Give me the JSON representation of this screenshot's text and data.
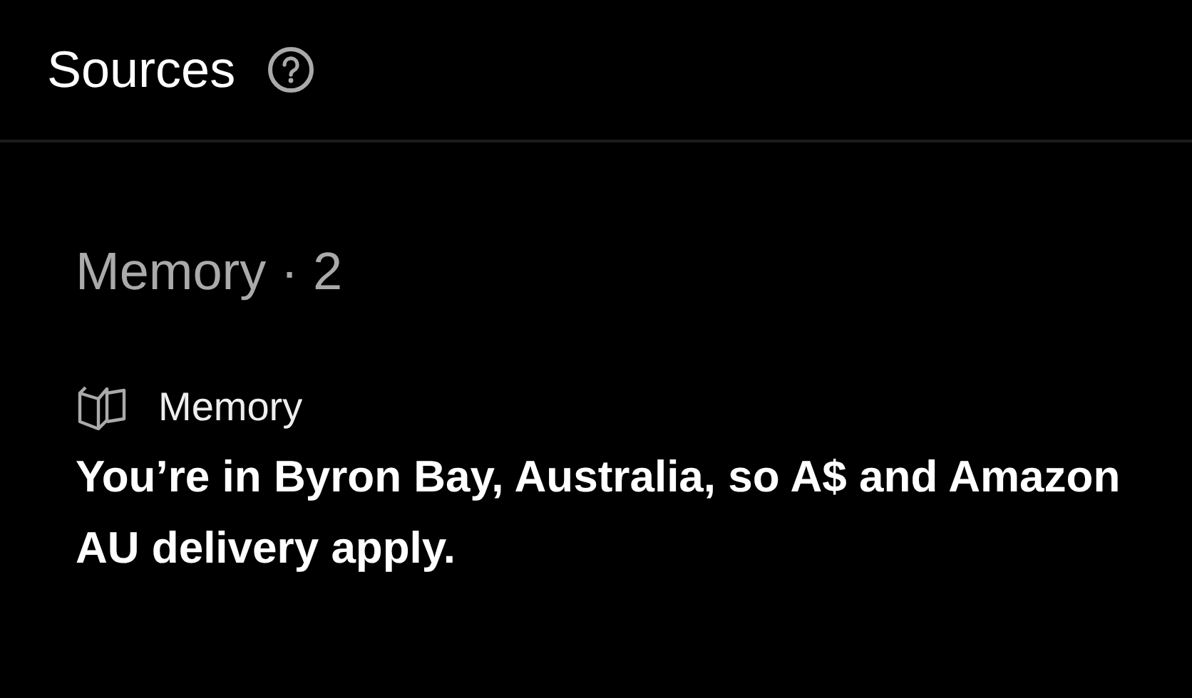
{
  "header": {
    "title": "Sources"
  },
  "sections": [
    {
      "title": "Memory · 2",
      "items": [
        {
          "kind": "memory",
          "source": "Memory",
          "text": "You’re in Byron Bay, Australia, so A$ and Amazon AU delivery apply."
        }
      ]
    }
  ]
}
